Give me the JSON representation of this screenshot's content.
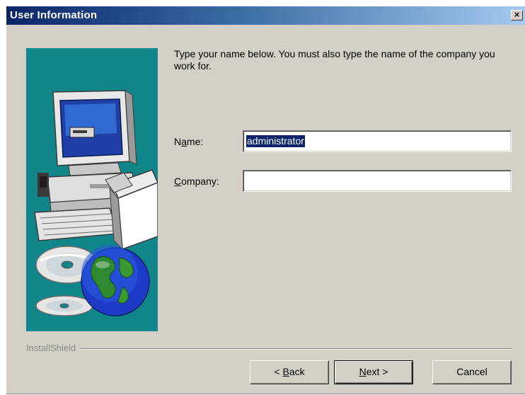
{
  "window": {
    "title": "User Information",
    "close_symbol": "×"
  },
  "instructions": "Type your name below. You must also type the name of the company you work for.",
  "form": {
    "name_label_prefix": "N",
    "name_label_mnemonic": "a",
    "name_label_suffix": "me:",
    "name_value": "administrator",
    "company_label_mnemonic": "C",
    "company_label_suffix": "ompany:",
    "company_value": ""
  },
  "footer": {
    "brand": "InstallShield"
  },
  "buttons": {
    "back_prefix": "< ",
    "back_mnemonic": "B",
    "back_suffix": "ack",
    "next_mnemonic": "N",
    "next_suffix": "ext >",
    "cancel": "Cancel"
  },
  "icons": [
    "computer-illustration-icon",
    "cd-disc-icon",
    "globe-icon",
    "close-icon"
  ],
  "colors": {
    "title_start": "#0a246a",
    "title_end": "#a6caf0",
    "panel_teal": "#10868a",
    "dialog_bg": "#d4d0c8",
    "selection": "#0a246a"
  }
}
